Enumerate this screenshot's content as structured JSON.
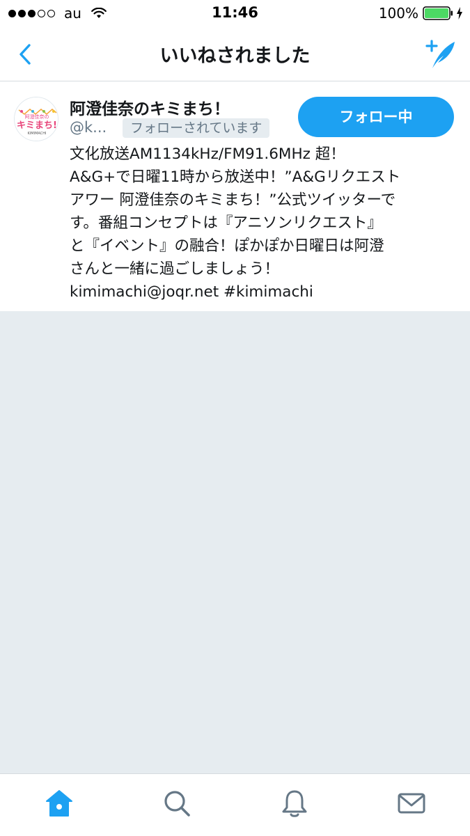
{
  "status_bar": {
    "carrier": "au",
    "time": "11:46",
    "battery": "100%",
    "signal_bars_filled": 3,
    "signal_bars_total": 5
  },
  "nav": {
    "title": "いいねされました",
    "back_icon": "chevron-left-icon",
    "compose_icon": "compose-tweet-icon"
  },
  "user": {
    "display_name": "阿澄佳奈のキミまち！",
    "screen_name": "@k...",
    "follows_you": "フォローされています",
    "follow_button": "フォロー中",
    "bio_lines": [
      "文化放送AM1134kHz/FM91.6MHz 超！",
      "A&G+で日曜11時から放送中！”A&Gリクエスト",
      "アワー 阿澄佳奈のキミまち！”公式ツイッターで",
      "す。番組コンセプトは『アニソンリクエスト』",
      "と『イベント』の融合！ぽかぽか日曜日は阿澄",
      "さんと一緒に過ごしましょう！",
      "kimimachi@joqr.net #kimimachi"
    ],
    "avatar_text": {
      "title": "キミまち!",
      "subtitle": "KIMIMACHI",
      "top": "阿澄佳奈の"
    }
  },
  "tab_bar": {
    "items": [
      {
        "name": "home",
        "icon": "home-icon",
        "active": true
      },
      {
        "name": "search",
        "icon": "search-icon",
        "active": false
      },
      {
        "name": "notifications",
        "icon": "bell-icon",
        "active": false
      },
      {
        "name": "messages",
        "icon": "envelope-icon",
        "active": false
      }
    ]
  },
  "colors": {
    "accent": "#1da1f2",
    "background": "#e6ecf0",
    "text": "#14171a",
    "secondary_text": "#657786",
    "inactive_icon": "#657786",
    "battery": "#4cd964"
  }
}
